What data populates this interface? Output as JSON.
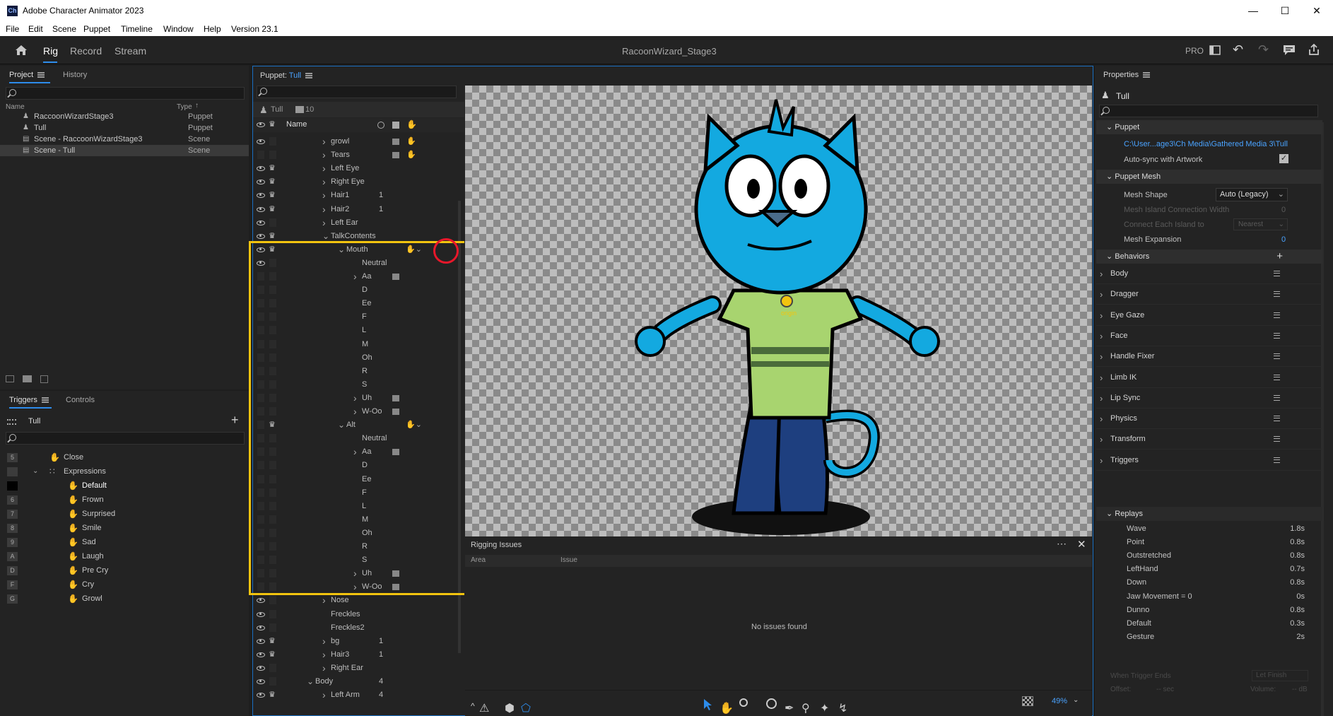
{
  "window": {
    "app_icon": "Ch",
    "title": "Adobe Character Animator 2023"
  },
  "menu": [
    "File",
    "Edit",
    "Scene",
    "Puppet",
    "Timeline",
    "Window",
    "Help",
    "Version 23.1"
  ],
  "modes": {
    "rig": "Rig",
    "record": "Record",
    "stream": "Stream",
    "document": "RacoonWizard_Stage3",
    "pro": "PRO"
  },
  "project": {
    "tab_project": "Project",
    "tab_history": "History",
    "col_name": "Name",
    "col_type": "Type",
    "items": [
      {
        "name": "RaccoonWizardStage3",
        "type": "Puppet"
      },
      {
        "name": "Tull",
        "type": "Puppet"
      },
      {
        "name": "Scene - RaccoonWizardStage3",
        "type": "Scene"
      },
      {
        "name": "Scene - Tull",
        "type": "Scene"
      }
    ]
  },
  "triggers": {
    "tab_triggers": "Triggers",
    "tab_controls": "Controls",
    "puppet": "Tull",
    "items": [
      {
        "key": "5",
        "label": "Close",
        "indent": 0
      },
      {
        "key": "",
        "label": "Expressions",
        "indent": 0
      },
      {
        "key": "",
        "label": "Default",
        "indent": 1
      },
      {
        "key": "6",
        "label": "Frown",
        "indent": 1
      },
      {
        "key": "7",
        "label": "Surprised",
        "indent": 1
      },
      {
        "key": "8",
        "label": "Smile",
        "indent": 1
      },
      {
        "key": "9",
        "label": "Sad",
        "indent": 1
      },
      {
        "key": "A",
        "label": "Laugh",
        "indent": 1
      },
      {
        "key": "D",
        "label": "Pre Cry",
        "indent": 1
      },
      {
        "key": "F",
        "label": "Cry",
        "indent": 1
      },
      {
        "key": "G",
        "label": "Growl",
        "indent": 1
      }
    ]
  },
  "puppet_panel": {
    "label": "Puppet:",
    "puppet": "Tull",
    "root": "Tull",
    "count": "10",
    "col_name": "Name",
    "layers": [
      {
        "name": "growl",
        "d": 2,
        "eye": 1,
        "crown": 0,
        "chev": 1,
        "n": "",
        "ic": 2
      },
      {
        "name": "Tears",
        "d": 2,
        "eye": 0,
        "crown": 0,
        "chev": 1,
        "n": "",
        "ic": 2
      },
      {
        "name": "Left Eye",
        "d": 2,
        "eye": 1,
        "crown": 1,
        "chev": 1,
        "n": "",
        "ic": 0
      },
      {
        "name": "Right Eye",
        "d": 2,
        "eye": 1,
        "crown": 1,
        "chev": 1,
        "n": "",
        "ic": 0
      },
      {
        "name": "Hair1",
        "d": 2,
        "eye": 1,
        "crown": 1,
        "chev": 1,
        "n": "1",
        "ic": 0
      },
      {
        "name": "Hair2",
        "d": 2,
        "eye": 1,
        "crown": 1,
        "chev": 1,
        "n": "1",
        "ic": 0
      },
      {
        "name": "Left Ear",
        "d": 2,
        "eye": 1,
        "crown": 0,
        "chev": 1,
        "n": "",
        "ic": 0
      },
      {
        "name": "TalkContents",
        "d": 2,
        "eye": 1,
        "crown": 1,
        "chev": 2,
        "n": "",
        "ic": 0
      },
      {
        "name": "Mouth",
        "d": 3,
        "eye": 1,
        "crown": 1,
        "chev": 2,
        "n": "",
        "ic": 3
      },
      {
        "name": "Neutral",
        "d": 4,
        "eye": 1,
        "crown": 0,
        "chev": 0,
        "n": "",
        "ic": 0
      },
      {
        "name": "Aa",
        "d": 4,
        "eye": 0,
        "crown": 0,
        "chev": 1,
        "n": "",
        "ic": 1
      },
      {
        "name": "D",
        "d": 4,
        "eye": 0,
        "crown": 0,
        "chev": 0,
        "n": "",
        "ic": 0
      },
      {
        "name": "Ee",
        "d": 4,
        "eye": 0,
        "crown": 0,
        "chev": 0,
        "n": "",
        "ic": 0
      },
      {
        "name": "F",
        "d": 4,
        "eye": 0,
        "crown": 0,
        "chev": 0,
        "n": "",
        "ic": 0
      },
      {
        "name": "L",
        "d": 4,
        "eye": 0,
        "crown": 0,
        "chev": 0,
        "n": "",
        "ic": 0
      },
      {
        "name": "M",
        "d": 4,
        "eye": 0,
        "crown": 0,
        "chev": 0,
        "n": "",
        "ic": 0
      },
      {
        "name": "Oh",
        "d": 4,
        "eye": 0,
        "crown": 0,
        "chev": 0,
        "n": "",
        "ic": 0
      },
      {
        "name": "R",
        "d": 4,
        "eye": 0,
        "crown": 0,
        "chev": 0,
        "n": "",
        "ic": 0
      },
      {
        "name": "S",
        "d": 4,
        "eye": 0,
        "crown": 0,
        "chev": 0,
        "n": "",
        "ic": 0
      },
      {
        "name": "Uh",
        "d": 4,
        "eye": 0,
        "crown": 0,
        "chev": 1,
        "n": "",
        "ic": 1
      },
      {
        "name": "W-Oo",
        "d": 4,
        "eye": 0,
        "crown": 0,
        "chev": 1,
        "n": "",
        "ic": 1
      },
      {
        "name": "Alt",
        "d": 3,
        "eye": 0,
        "crown": 1,
        "chev": 2,
        "n": "",
        "ic": 3
      },
      {
        "name": "Neutral",
        "d": 4,
        "eye": 0,
        "crown": 0,
        "chev": 0,
        "n": "",
        "ic": 0
      },
      {
        "name": "Aa",
        "d": 4,
        "eye": 0,
        "crown": 0,
        "chev": 1,
        "n": "",
        "ic": 1
      },
      {
        "name": "D",
        "d": 4,
        "eye": 0,
        "crown": 0,
        "chev": 0,
        "n": "",
        "ic": 0
      },
      {
        "name": "Ee",
        "d": 4,
        "eye": 0,
        "crown": 0,
        "chev": 0,
        "n": "",
        "ic": 0
      },
      {
        "name": "F",
        "d": 4,
        "eye": 0,
        "crown": 0,
        "chev": 0,
        "n": "",
        "ic": 0
      },
      {
        "name": "L",
        "d": 4,
        "eye": 0,
        "crown": 0,
        "chev": 0,
        "n": "",
        "ic": 0
      },
      {
        "name": "M",
        "d": 4,
        "eye": 0,
        "crown": 0,
        "chev": 0,
        "n": "",
        "ic": 0
      },
      {
        "name": "Oh",
        "d": 4,
        "eye": 0,
        "crown": 0,
        "chev": 0,
        "n": "",
        "ic": 0
      },
      {
        "name": "R",
        "d": 4,
        "eye": 0,
        "crown": 0,
        "chev": 0,
        "n": "",
        "ic": 0
      },
      {
        "name": "S",
        "d": 4,
        "eye": 0,
        "crown": 0,
        "chev": 0,
        "n": "",
        "ic": 0
      },
      {
        "name": "Uh",
        "d": 4,
        "eye": 0,
        "crown": 0,
        "chev": 1,
        "n": "",
        "ic": 1
      },
      {
        "name": "W-Oo",
        "d": 4,
        "eye": 0,
        "crown": 0,
        "chev": 1,
        "n": "",
        "ic": 1
      },
      {
        "name": "Nose",
        "d": 2,
        "eye": 1,
        "crown": 0,
        "chev": 1,
        "n": "",
        "ic": 0
      },
      {
        "name": "Freckles",
        "d": 2,
        "eye": 1,
        "crown": 0,
        "chev": 0,
        "n": "",
        "ic": 0
      },
      {
        "name": "Freckles2",
        "d": 2,
        "eye": 1,
        "crown": 0,
        "chev": 0,
        "n": "",
        "ic": 0
      },
      {
        "name": "bg",
        "d": 2,
        "eye": 1,
        "crown": 1,
        "chev": 1,
        "n": "1",
        "ic": 0
      },
      {
        "name": "Hair3",
        "d": 2,
        "eye": 1,
        "crown": 1,
        "chev": 1,
        "n": "1",
        "ic": 0
      },
      {
        "name": "Right Ear",
        "d": 2,
        "eye": 1,
        "crown": 0,
        "chev": 1,
        "n": "",
        "ic": 0
      },
      {
        "name": "Body",
        "d": 1,
        "eye": 1,
        "crown": 0,
        "chev": 2,
        "n": "4",
        "ic": 0
      },
      {
        "name": "Left Arm",
        "d": 2,
        "eye": 1,
        "crown": 1,
        "chev": 1,
        "n": "4",
        "ic": 0
      }
    ]
  },
  "stage": {
    "badge": "origin",
    "zoom": "49%"
  },
  "rigging": {
    "title": "Rigging Issues",
    "col_area": "Area",
    "col_issue": "Issue",
    "empty": "No issues found"
  },
  "properties": {
    "title": "Properties",
    "puppet": "Tull",
    "puppet_section": "Puppet",
    "path": "C:\\User...age3\\Ch Media\\Gathered Media 3\\Tull",
    "autosync": "Auto-sync with Artwork",
    "mesh_section": "Puppet Mesh",
    "mesh_shape_label": "Mesh Shape",
    "mesh_shape_value": "Auto (Legacy)",
    "island_width_label": "Mesh Island Connection Width",
    "island_width_value": "0",
    "connect_label": "Connect Each Island to",
    "connect_value": "Nearest",
    "expansion_label": "Mesh Expansion",
    "expansion_value": "0",
    "behaviors_section": "Behaviors",
    "behaviors": [
      "Body",
      "Dragger",
      "Eye Gaze",
      "Face",
      "Handle Fixer",
      "Limb IK",
      "Lip Sync",
      "Physics",
      "Transform",
      "Triggers"
    ],
    "replays_section": "Replays",
    "replays": [
      {
        "name": "Wave",
        "dur": "1.8s"
      },
      {
        "name": "Point",
        "dur": "0.8s"
      },
      {
        "name": "Outstretched",
        "dur": "0.8s"
      },
      {
        "name": "LeftHand",
        "dur": "0.7s"
      },
      {
        "name": "Down",
        "dur": "0.8s"
      },
      {
        "name": "Jaw Movement = 0",
        "dur": "0s"
      },
      {
        "name": "Dunno",
        "dur": "0.8s"
      },
      {
        "name": "Default",
        "dur": "0.3s"
      },
      {
        "name": "Gesture",
        "dur": "2s"
      }
    ],
    "when_trigger_ends": "When Trigger Ends",
    "when_value": "Let Finish",
    "offset_label": "Offset:",
    "offset_value": "-- sec",
    "volume_label": "Volume:",
    "volume_value": "-- dB"
  },
  "colors": {
    "accent": "#2d8ceb",
    "highlight": "#f2c40f",
    "marker": "#e8172a",
    "panel": "#232323"
  }
}
